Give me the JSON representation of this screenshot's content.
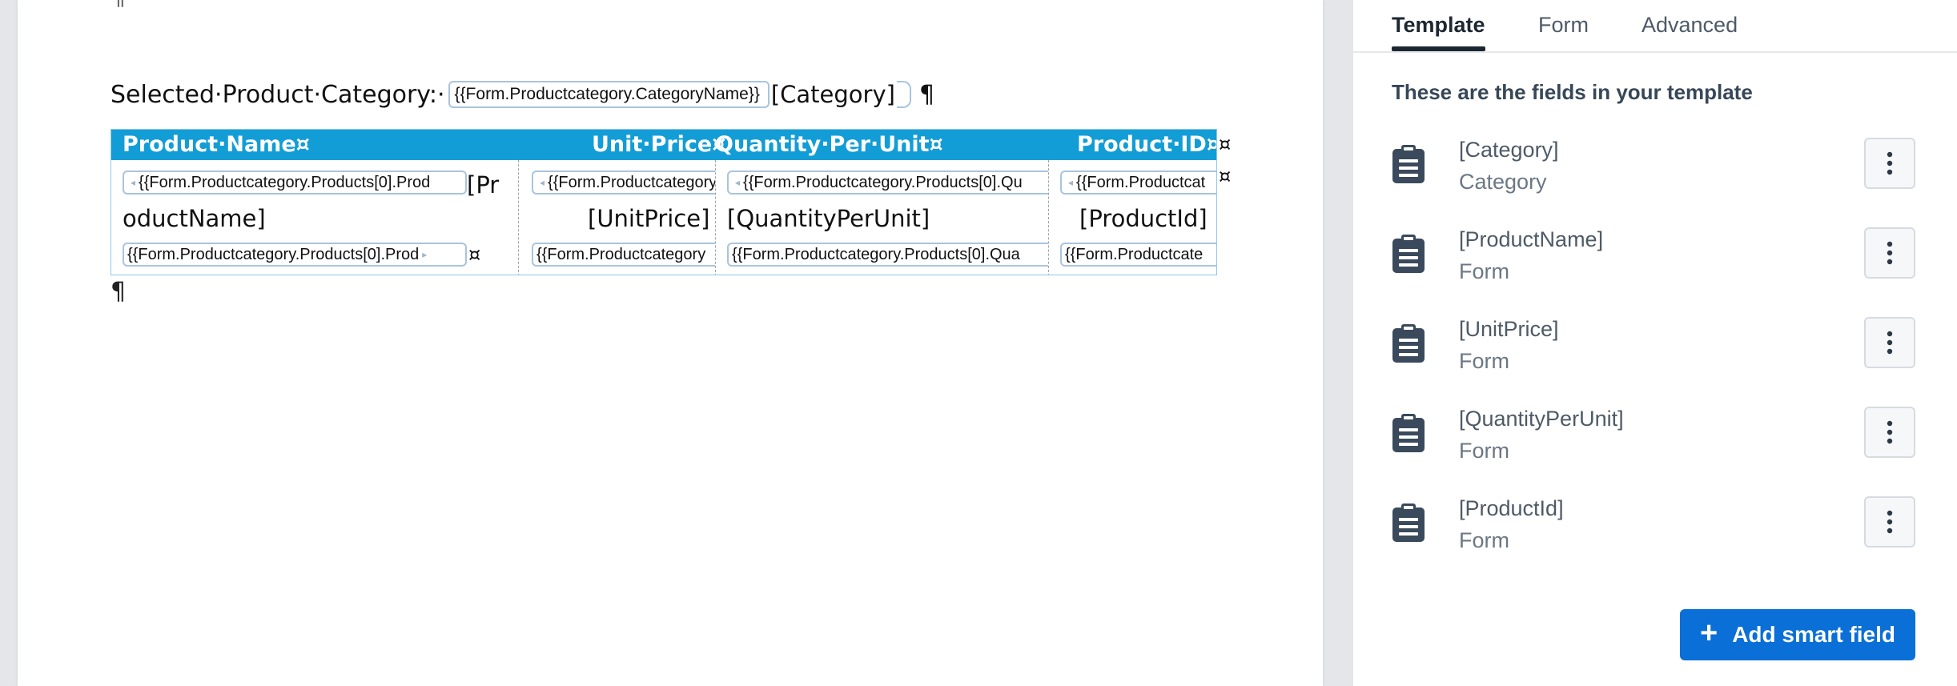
{
  "document": {
    "para_mark": "¶",
    "cell_end_mark": "¤",
    "category_line": {
      "label": "Selected·Product·Category:·",
      "tag": "{{Form.Productcategory.CategoryName}}",
      "field": "[Category]"
    },
    "table": {
      "headers": [
        "Product·Name¤",
        "Unit·Price¤",
        "Quantity·Per·Unit¤",
        "Product·ID¤"
      ],
      "cells": [
        {
          "tag_top": "{{Form.Productcategory.Products[0].Prod",
          "field_part1": "[Pr",
          "field_part2": "oductName]",
          "tag_bottom": "{{Form.Productcategory.Products[0].Prod"
        },
        {
          "tag_top": "{{Form.Productcategory",
          "field": "[UnitPrice]",
          "tag_bottom": "{{Form.Productcategory"
        },
        {
          "tag_top": "{{Form.Productcategory.Products[0].Qu",
          "field": "[QuantityPerUnit]",
          "tag_bottom": "{{Form.Productcategory.Products[0].Qua"
        },
        {
          "tag_top": "{{Form.Productcat",
          "field": "[ProductId]",
          "tag_bottom": "{{Form.Productcate"
        }
      ]
    }
  },
  "panel": {
    "tabs": [
      {
        "label": "Template",
        "active": true
      },
      {
        "label": "Form",
        "active": false
      },
      {
        "label": "Advanced",
        "active": false
      }
    ],
    "heading": "These are the fields in your template",
    "fields": [
      {
        "name": "[Category]",
        "type": "Category"
      },
      {
        "name": "[ProductName]",
        "type": "Form"
      },
      {
        "name": "[UnitPrice]",
        "type": "Form"
      },
      {
        "name": "[QuantityPerUnit]",
        "type": "Form"
      },
      {
        "name": "[ProductId]",
        "type": "Form"
      }
    ],
    "add_button": {
      "icon": "plus-icon",
      "label": "Add smart field"
    }
  },
  "colors": {
    "header_blue": "#139dd6",
    "tag_border": "#a9c4df",
    "primary_button": "#0a6fd6",
    "icon_dark": "#3a4a5c"
  }
}
